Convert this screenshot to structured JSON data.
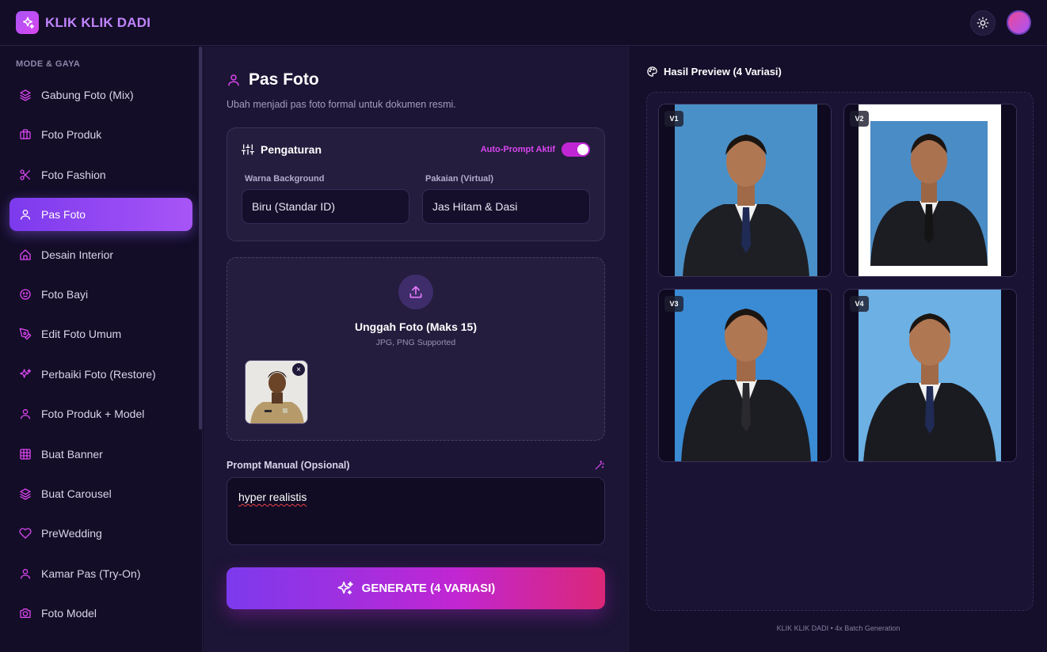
{
  "app": {
    "brand": "KLIK KLIK DADI"
  },
  "sidebar": {
    "section_title": "MODE & GAYA",
    "items": [
      {
        "label": "Gabung Foto (Mix)",
        "icon": "layers-icon"
      },
      {
        "label": "Foto Produk",
        "icon": "briefcase-icon"
      },
      {
        "label": "Foto Fashion",
        "icon": "scissors-icon"
      },
      {
        "label": "Pas Foto",
        "icon": "user-icon",
        "active": true
      },
      {
        "label": "Desain Interior",
        "icon": "home-icon"
      },
      {
        "label": "Foto Bayi",
        "icon": "baby-icon"
      },
      {
        "label": "Edit Foto Umum",
        "icon": "pen-tool-icon"
      },
      {
        "label": "Perbaiki Foto (Restore)",
        "icon": "sparkles-icon"
      },
      {
        "label": "Foto Produk + Model",
        "icon": "user-icon"
      },
      {
        "label": "Buat Banner",
        "icon": "grid-icon"
      },
      {
        "label": "Buat Carousel",
        "icon": "layers-icon"
      },
      {
        "label": "PreWedding",
        "icon": "heart-icon"
      },
      {
        "label": "Kamar Pas (Try-On)",
        "icon": "user-icon"
      },
      {
        "label": "Foto Model",
        "icon": "camera-icon"
      }
    ]
  },
  "main": {
    "title": "Pas Foto",
    "subtitle": "Ubah menjadi pas foto formal untuk dokumen resmi.",
    "settings": {
      "title": "Pengaturan",
      "auto_prompt_label": "Auto-Prompt Aktif",
      "auto_prompt_on": true,
      "background_label": "Warna Background",
      "background_value": "Biru (Standar ID)",
      "clothing_label": "Pakaian (Virtual)",
      "clothing_value": "Jas Hitam & Dasi"
    },
    "upload": {
      "title": "Unggah Foto (Maks 15)",
      "subtitle": "JPG, PNG Supported",
      "remove_label": "×"
    },
    "prompt": {
      "label": "Prompt Manual (Opsional)",
      "value": "hyper realistis"
    },
    "generate_label": "GENERATE (4 VARIASI)"
  },
  "preview": {
    "title": "Hasil Preview (4 Variasi)",
    "variants": [
      "V1",
      "V2",
      "V3",
      "V4"
    ],
    "footer": "KLIK KLIK DADI • 4x Batch Generation"
  },
  "colors": {
    "accent": "#a855f7",
    "accent_pink": "#d946ef",
    "background": "#150f2b",
    "photo_blue": "#3d8ad0"
  }
}
